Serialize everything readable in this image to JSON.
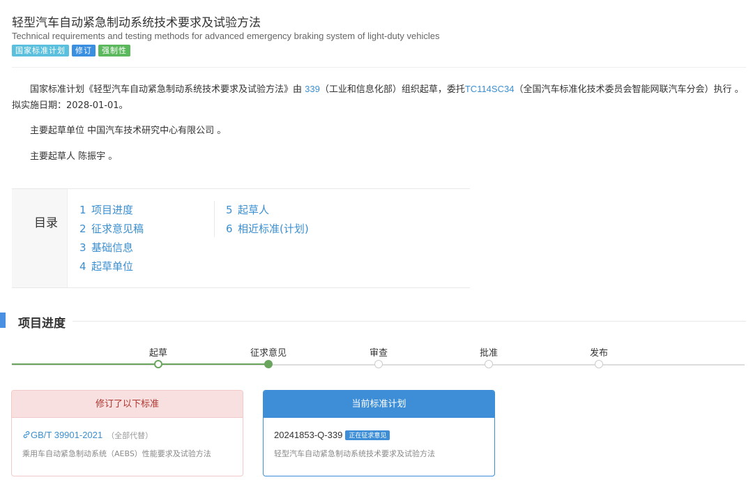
{
  "header": {
    "title": "轻型汽车自动紧急制动系统技术要求及试验方法",
    "subtitle": "Technical requirements and testing methods for advanced emergency braking system of light-duty vehicles",
    "tags": [
      "国家标准计划",
      "修订",
      "强制性"
    ]
  },
  "intro": {
    "p1_before": "国家标准计划《轻型汽车自动紧急制动系统技术要求及试验方法》由 ",
    "p1_link1": "339",
    "p1_middle": "（工业和信息化部）组织起草，委托",
    "p1_link2": "TC114SC34",
    "p1_after": "（全国汽车标准化技术委员会智能网联汽车分会）执行 。 拟实施日期：2028-01-01。",
    "drafting_unit": "主要起草单位 中国汽车技术研究中心有限公司 。",
    "drafter": "主要起草人 陈振宇 。"
  },
  "toc": {
    "label": "目录",
    "col1": [
      {
        "num": "1",
        "label": "项目进度"
      },
      {
        "num": "2",
        "label": "征求意见稿"
      },
      {
        "num": "3",
        "label": "基础信息"
      },
      {
        "num": "4",
        "label": "起草单位"
      }
    ],
    "col2": [
      {
        "num": "5",
        "label": "起草人"
      },
      {
        "num": "6",
        "label": "相近标准(计划)"
      }
    ]
  },
  "progress": {
    "section_title": "项目进度",
    "steps": [
      "起草",
      "征求意见",
      "审查",
      "批准",
      "发布"
    ],
    "completed_steps": 2
  },
  "cards": {
    "revised": {
      "header": "修订了以下标准",
      "std_code": "GB/T 39901-2021",
      "replace_note": "（全部代替）",
      "std_name": "乘用车自动紧急制动系统（AEBS）性能要求及试验方法"
    },
    "current": {
      "header": "当前标准计划",
      "plan_code": "20241853-Q-339",
      "status": "正在征求意见",
      "plan_name": "轻型汽车自动紧急制动系统技术要求及试验方法"
    }
  },
  "colors": {
    "link": "#3b8fd0",
    "accent": "#3d8ed6",
    "done": "#6aa55e",
    "revised_header_bg": "#f9e0e0"
  }
}
